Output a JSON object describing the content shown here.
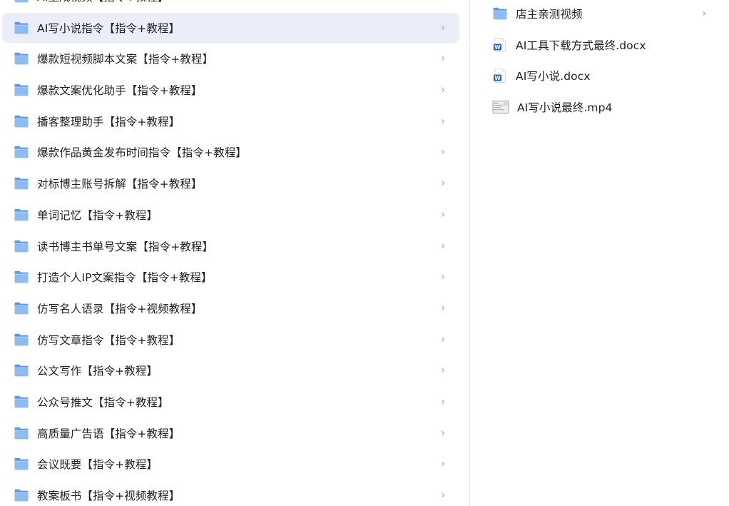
{
  "left_pane": {
    "items": [
      {
        "label": "AI生成视频【指令+教程】",
        "selected": false
      },
      {
        "label": "AI写小说指令【指令+教程】",
        "selected": true
      },
      {
        "label": "爆款短视频脚本文案【指令+教程】",
        "selected": false
      },
      {
        "label": "爆款文案优化助手【指令+教程】",
        "selected": false
      },
      {
        "label": "播客整理助手【指令+教程】",
        "selected": false
      },
      {
        "label": "爆款作品黄金发布时间指令【指令+教程】",
        "selected": false
      },
      {
        "label": "对标博主账号拆解【指令+教程】",
        "selected": false
      },
      {
        "label": "单词记忆【指令+教程】",
        "selected": false
      },
      {
        "label": "读书博主书单号文案【指令+教程】",
        "selected": false
      },
      {
        "label": "打造个人IP文案指令【指令+教程】",
        "selected": false
      },
      {
        "label": "仿写名人语录【指令+视频教程】",
        "selected": false
      },
      {
        "label": "仿写文章指令【指令+教程】",
        "selected": false
      },
      {
        "label": "公文写作【指令+教程】",
        "selected": false
      },
      {
        "label": "公众号推文【指令+教程】",
        "selected": false
      },
      {
        "label": "高质量广告语【指令+教程】",
        "selected": false
      },
      {
        "label": "会议既要【指令+教程】",
        "selected": false
      },
      {
        "label": "教案板书【指令+视频教程】",
        "selected": false
      }
    ]
  },
  "right_pane": {
    "items": [
      {
        "label": "店主亲测视频",
        "icon": "folder-icon",
        "has_chevron": true
      },
      {
        "label": "AI工具下载方式最终.docx",
        "icon": "word-doc-icon",
        "has_chevron": false
      },
      {
        "label": "AI写小说.docx",
        "icon": "word-doc-icon",
        "has_chevron": false
      },
      {
        "label": "AI写小说最终.mp4",
        "icon": "video-file-icon",
        "has_chevron": false
      }
    ]
  },
  "glyphs": {
    "chevron": "›"
  },
  "colors": {
    "selected_row_bg": "#ebeef8",
    "folder_blue": "#7fb2ec",
    "word_blue": "#2b5fc4"
  }
}
